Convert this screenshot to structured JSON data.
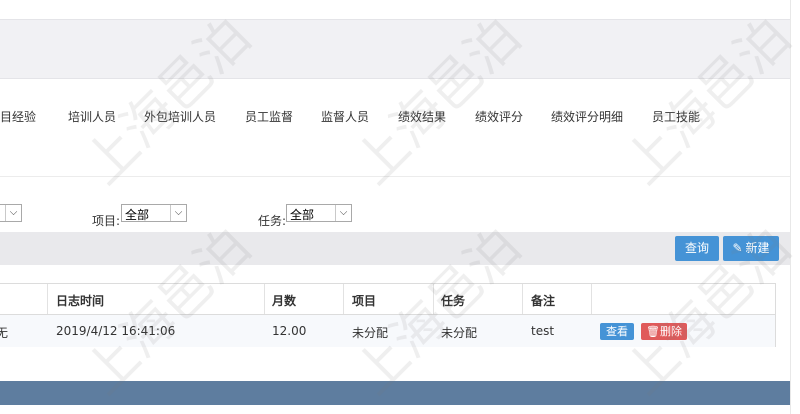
{
  "tabs": [
    "目经验",
    "培训人员",
    "外包培训人员",
    "员工监督",
    "监督人员",
    "绩效结果",
    "绩效评分",
    "绩效评分明细",
    "员工技能"
  ],
  "filters": {
    "project_label": "项目:",
    "project_value": "全部",
    "task_label": "任务:",
    "task_value": "全部",
    "first_value": ""
  },
  "toolbar": {
    "query": "查询",
    "new": "新建"
  },
  "table": {
    "headers": [
      "日志时间",
      "月数",
      "项目",
      "任务",
      "备注"
    ],
    "rows": [
      {
        "first": "无",
        "time": "2019/4/12 16:41:06",
        "months": "12.00",
        "project": "未分配",
        "task": "未分配",
        "remark": "test",
        "view": "查看",
        "delete": "删除"
      }
    ]
  },
  "watermark": "上海邑泊",
  "colors": {
    "primary": "#4593d6",
    "danger": "#e05a5a",
    "footer": "#5e7d9f"
  }
}
